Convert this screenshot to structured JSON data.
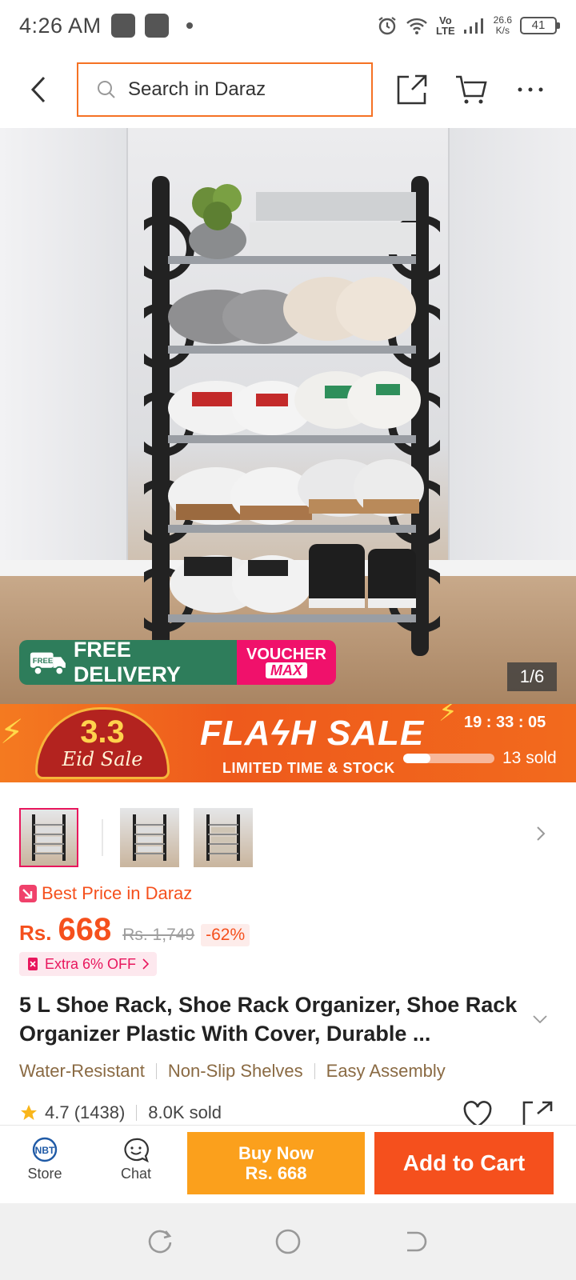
{
  "status_bar": {
    "time": "4:26 AM",
    "network": "Vo\nLTE",
    "speed": "26.6\nK/s",
    "battery": "41"
  },
  "header": {
    "search_placeholder": "Search in Daraz"
  },
  "hero": {
    "delivery_label": "FREE DELIVERY",
    "free_tag": "FREE",
    "voucher_line1": "VOUCHER",
    "voucher_line2": "MAX",
    "page_indicator": "1/6"
  },
  "flash_sale": {
    "eid_number": "3.3",
    "eid_text": "Eid Sale",
    "title": "FLAϟH SALE",
    "subtitle": "LIMITED TIME & STOCK",
    "countdown": "19 : 33 : 05",
    "sold_text": "13 sold",
    "sold_fraction": 0.3
  },
  "product": {
    "best_price_label": "Best Price in Daraz",
    "currency": "Rs.",
    "price": "668",
    "old_price": "Rs. 1,749",
    "discount": "-62%",
    "extra_off": "Extra 6% OFF",
    "title": "5 L Shoe Rack, Shoe Rack Organizer, Shoe Rack Organizer Plastic With Cover, Durable ...",
    "features": [
      "Water-Resistant",
      "Non-Slip Shelves",
      "Easy Assembly"
    ],
    "rating": "4.7 (1438)",
    "sold": "8.0K sold"
  },
  "bottom_bar": {
    "store_label": "Store",
    "store_logo": "NBT",
    "chat_label": "Chat",
    "buy_now_line1": "Buy Now",
    "buy_now_line2": "Rs. 668",
    "add_to_cart": "Add to Cart"
  },
  "colors": {
    "accent": "#f5501d",
    "buy_now": "#fba01c",
    "delivery_green": "#2e7d5b",
    "voucher_pink": "#f0116b"
  }
}
